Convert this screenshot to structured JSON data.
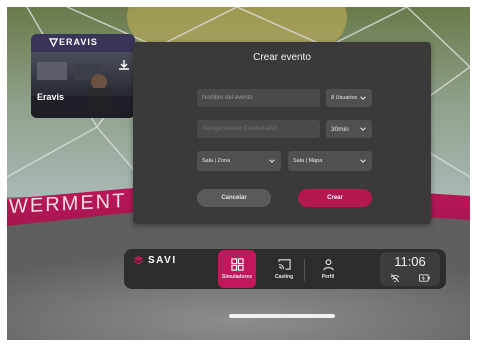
{
  "background": {
    "banner_text": "WERMENT"
  },
  "card": {
    "logo": "ERAVIS",
    "title": "Eravis",
    "icons": [
      "eravis-logo-icon",
      "download-icon"
    ]
  },
  "modal": {
    "title": "Crear evento",
    "event_name_placeholder": "Nombre del evento",
    "users_select": "8 Usuarios",
    "simulator_field": "Aerogenerador Colaborativo",
    "duration_select": "30min",
    "room_select": "Sala | Zona",
    "map_select": "Sala | Mapa",
    "cancel_label": "Cancelar",
    "create_label": "Crear"
  },
  "taskbar": {
    "brand": "SAVI",
    "items": [
      {
        "label": "Simuladores",
        "icon": "grid-icon",
        "active": true
      },
      {
        "label": "Casting",
        "icon": "cast-icon",
        "active": false
      },
      {
        "label": "Perfil",
        "icon": "profile-icon",
        "active": false
      }
    ],
    "time": "11:06",
    "status_icons": [
      "wifi-off-icon",
      "battery-icon"
    ]
  },
  "colors": {
    "accent": "#c2185b",
    "panel": "#3a3a3a",
    "taskbar": "#2d2d2d"
  }
}
